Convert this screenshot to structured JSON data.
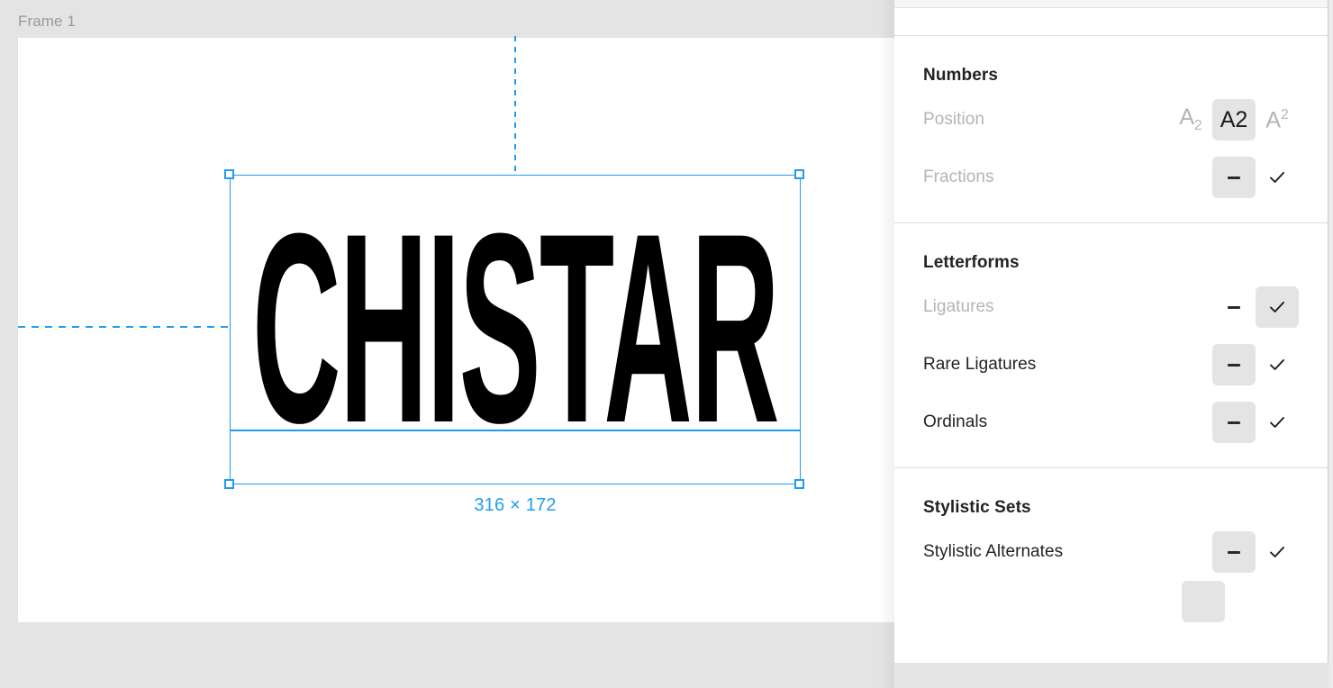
{
  "canvas": {
    "frame_label": "Frame 1",
    "artwork_text": "CHISTAR",
    "size_badge": "316 × 172",
    "selection_color": "#1f9cf0",
    "background_color": "#e4e4e4",
    "frame_background": "#ffffff"
  },
  "panel": {
    "sections": [
      {
        "title": "Numbers",
        "rows": [
          {
            "label": "Position",
            "muted": true,
            "type": "position",
            "options": [
              {
                "glyph": "A",
                "variant": "sub",
                "sub": "2",
                "selected": false
              },
              {
                "glyph": "A2",
                "variant": "normal",
                "selected": true
              },
              {
                "glyph": "A",
                "variant": "sup",
                "sup": "2",
                "selected": false
              }
            ]
          },
          {
            "label": "Fractions",
            "muted": true,
            "type": "toggle",
            "dash_selected": true,
            "check_selected": false
          }
        ]
      },
      {
        "title": "Letterforms",
        "rows": [
          {
            "label": "Ligatures",
            "muted": true,
            "type": "toggle",
            "dash_selected": false,
            "check_selected": true
          },
          {
            "label": "Rare Ligatures",
            "muted": false,
            "type": "toggle",
            "dash_selected": true,
            "check_selected": false
          },
          {
            "label": "Ordinals",
            "muted": false,
            "type": "toggle",
            "dash_selected": true,
            "check_selected": false
          }
        ]
      },
      {
        "title": "Stylistic Sets",
        "rows": [
          {
            "label": "Stylistic Alternates",
            "muted": false,
            "type": "toggle",
            "dash_selected": true,
            "check_selected": false
          }
        ]
      }
    ]
  }
}
